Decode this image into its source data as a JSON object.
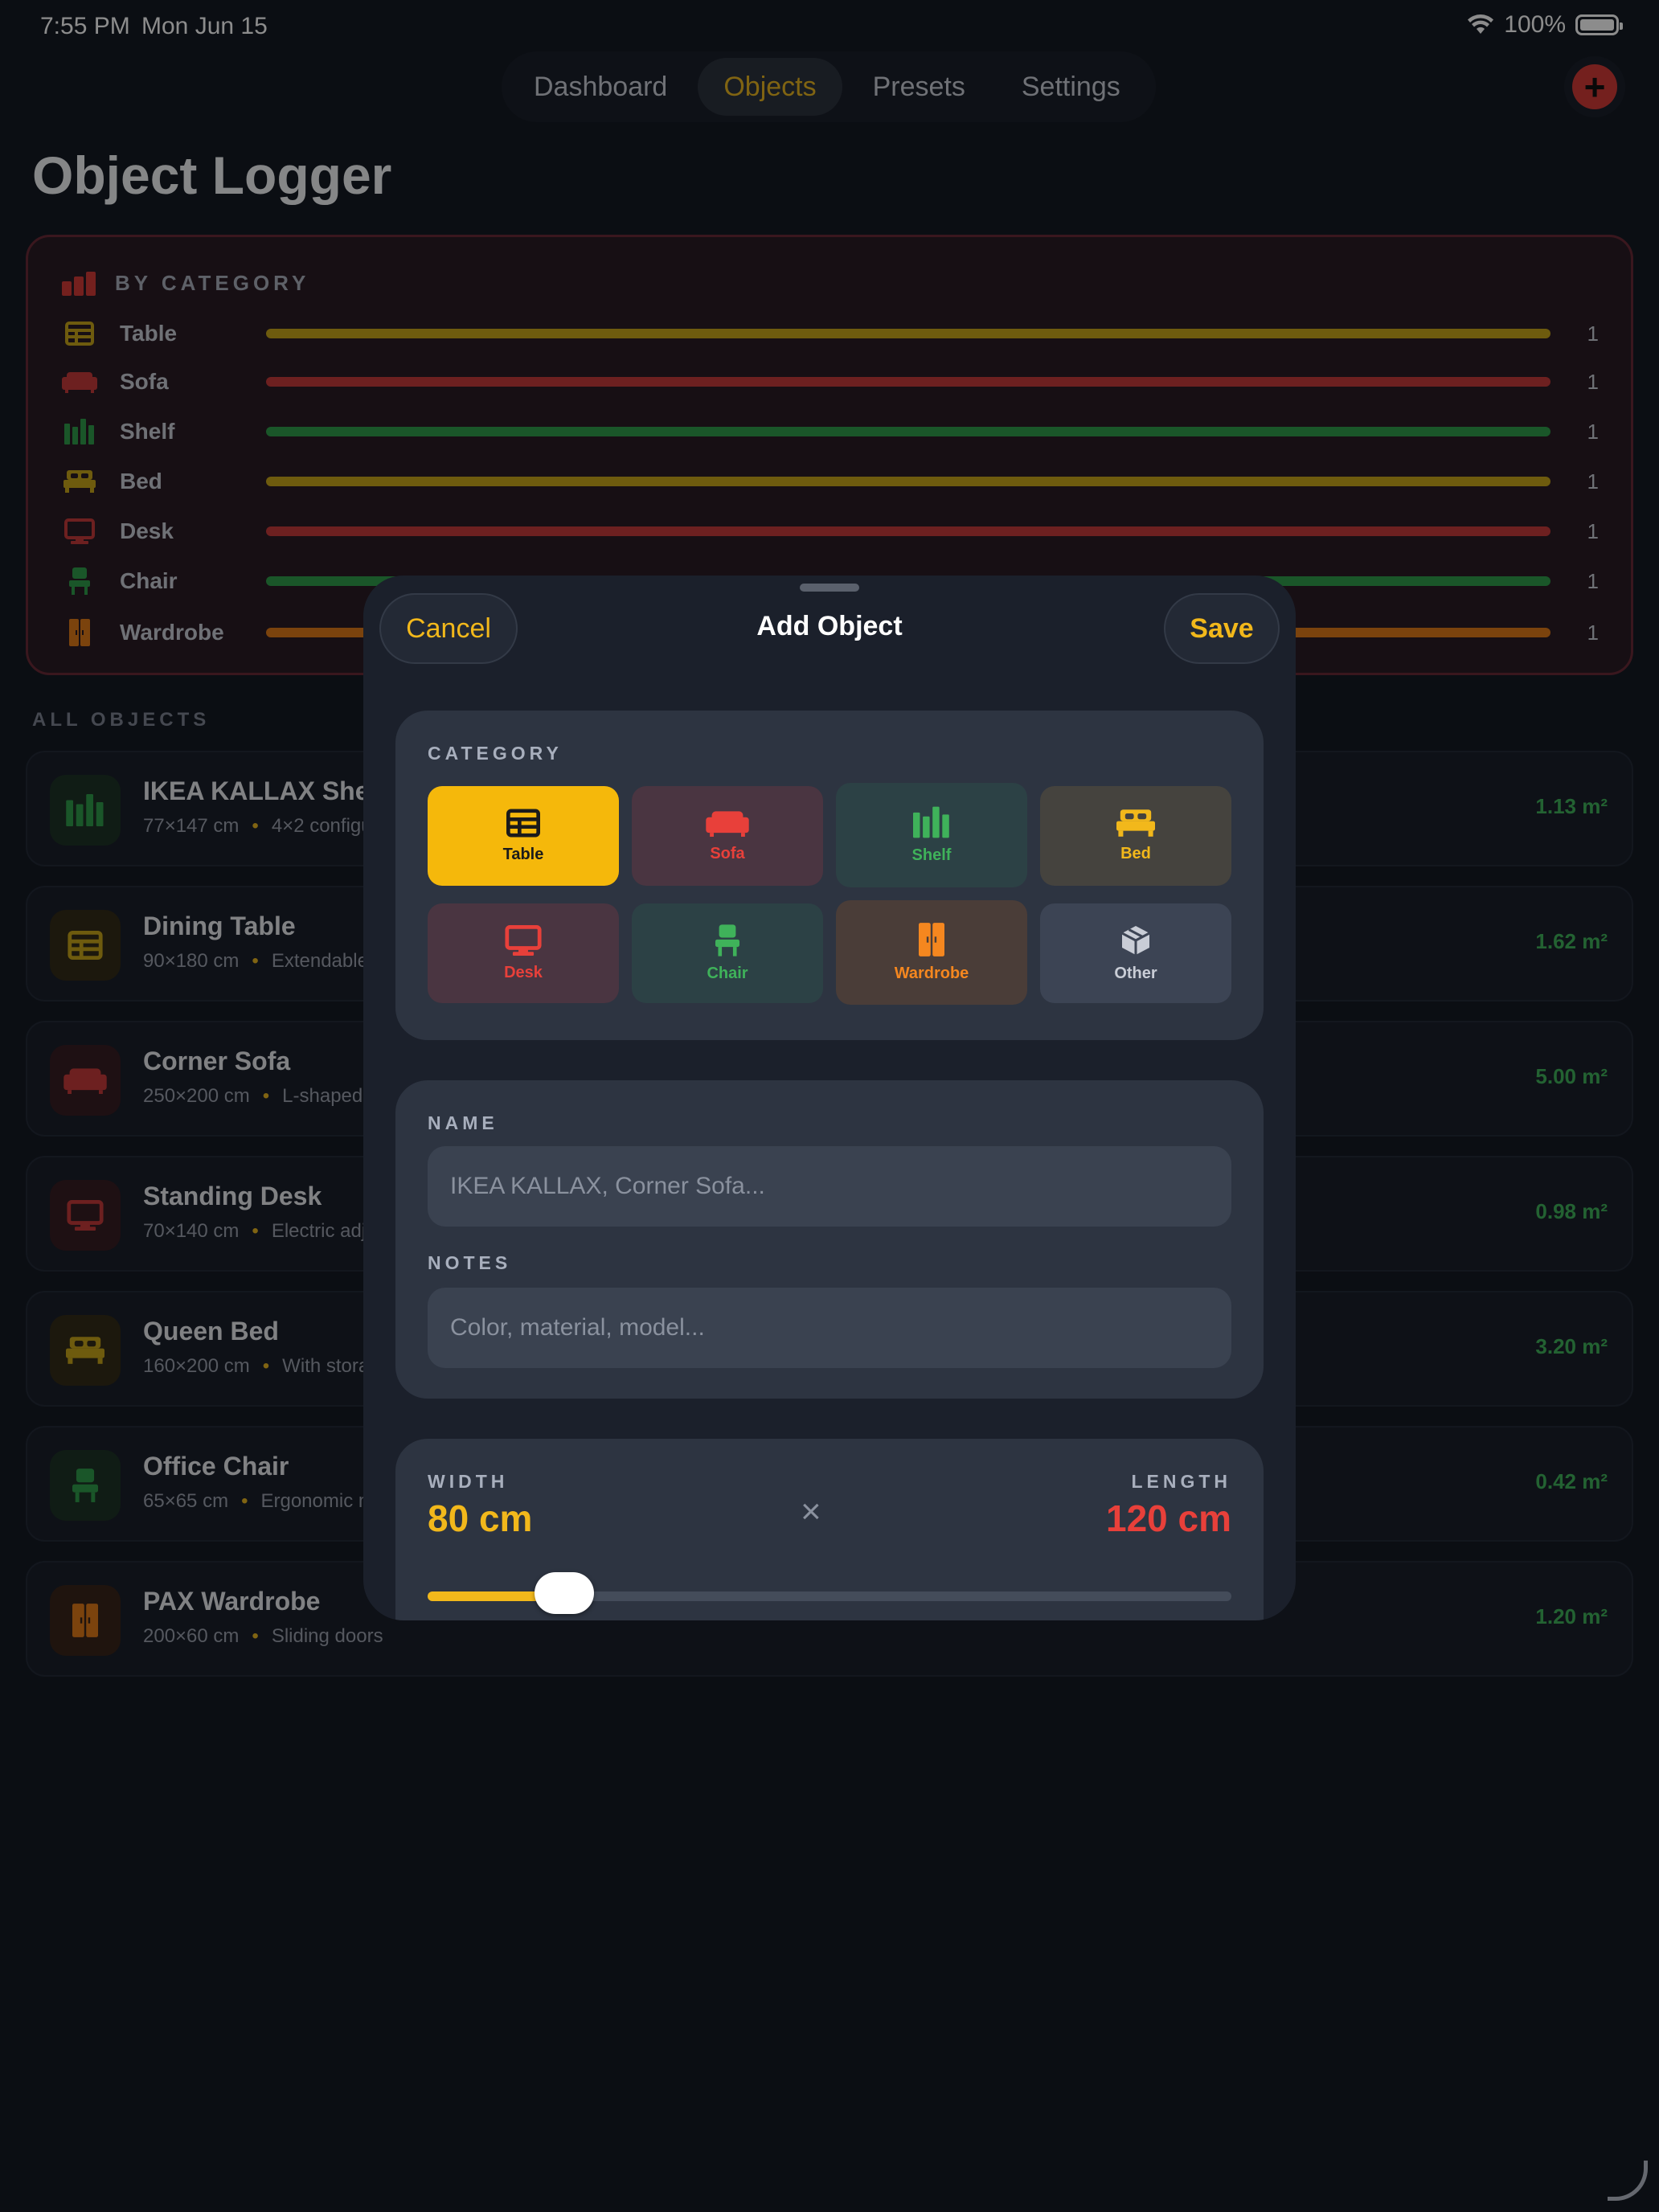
{
  "status": {
    "time": "7:55 PM",
    "date": "Mon Jun 15",
    "battery": "100%"
  },
  "nav": {
    "tabs": [
      "Dashboard",
      "Objects",
      "Presets",
      "Settings"
    ],
    "active": "Objects"
  },
  "page": {
    "title": "Object Logger"
  },
  "by_category": {
    "label": "BY CATEGORY",
    "rows": [
      {
        "name": "Table",
        "count": "1",
        "color": "#c8a51a"
      },
      {
        "name": "Sofa",
        "count": "1",
        "color": "#c73a3a"
      },
      {
        "name": "Shelf",
        "count": "1",
        "color": "#2f9c4a"
      },
      {
        "name": "Bed",
        "count": "1",
        "color": "#c8a51a"
      },
      {
        "name": "Desk",
        "count": "1",
        "color": "#c73a3a"
      },
      {
        "name": "Chair",
        "count": "1",
        "color": "#2f9c4a"
      },
      {
        "name": "Wardrobe",
        "count": "1",
        "color": "#e07a18"
      }
    ]
  },
  "all_objects": {
    "label": "ALL OBJECTS",
    "items": [
      {
        "name": "IKEA KALLAX Shelf",
        "dims": "77×147 cm",
        "note": "4×2 configu",
        "area": "1.13 m²"
      },
      {
        "name": "Dining Table",
        "dims": "90×180 cm",
        "note": "Extendable",
        "area": "1.62 m²"
      },
      {
        "name": "Corner Sofa",
        "dims": "250×200 cm",
        "note": "L-shaped,",
        "area": "5.00 m²"
      },
      {
        "name": "Standing Desk",
        "dims": "70×140 cm",
        "note": "Electric adju",
        "area": "0.98 m²"
      },
      {
        "name": "Queen Bed",
        "dims": "160×200 cm",
        "note": "With stora",
        "area": "3.20 m²"
      },
      {
        "name": "Office Chair",
        "dims": "65×65 cm",
        "note": "Ergonomic m",
        "area": "0.42 m²"
      },
      {
        "name": "PAX Wardrobe",
        "dims": "200×60 cm",
        "note": "Sliding doors",
        "area": "1.20 m²"
      }
    ]
  },
  "sheet": {
    "title": "Add Object",
    "cancel": "Cancel",
    "save": "Save",
    "category": {
      "label": "CATEGORY",
      "selected": "Table",
      "options": [
        "Table",
        "Sofa",
        "Shelf",
        "Bed",
        "Desk",
        "Chair",
        "Wardrobe",
        "Other"
      ]
    },
    "name": {
      "label": "NAME",
      "placeholder": "IKEA KALLAX, Corner Sofa..."
    },
    "notes": {
      "label": "NOTES",
      "placeholder": "Color, material, model..."
    },
    "dimensions": {
      "width_label": "WIDTH",
      "length_label": "LENGTH",
      "width": "80 cm",
      "length": "120 cm",
      "times": "×",
      "slider_value_fraction": 0.17
    }
  },
  "colors": {
    "accent": "#f2b81b",
    "red": "#e8403a",
    "green": "#3fb25a",
    "orange": "#e07a18"
  }
}
